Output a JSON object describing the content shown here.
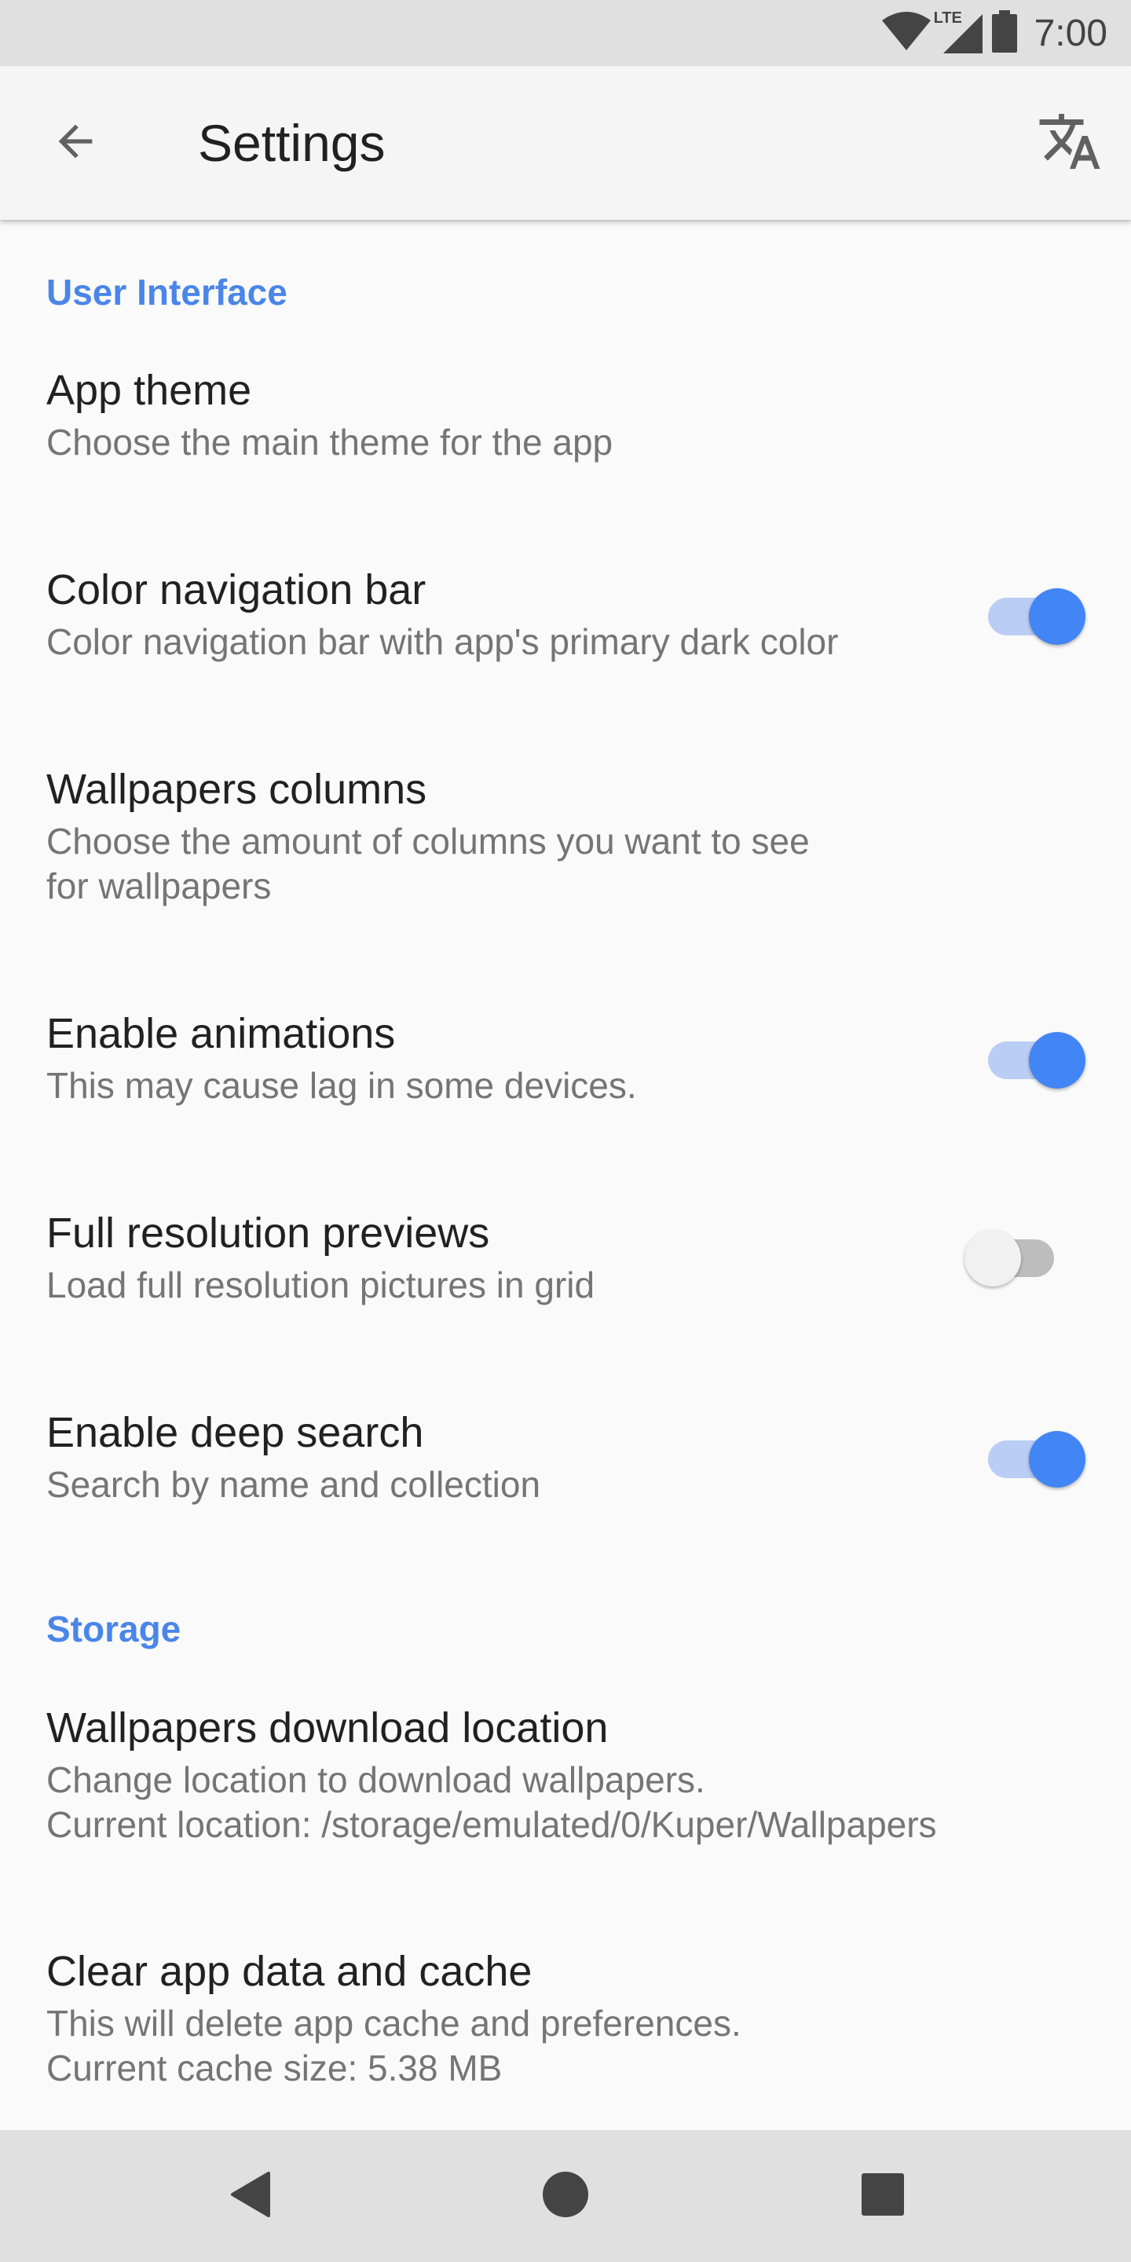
{
  "status_bar": {
    "time": "7:00",
    "icons": [
      "wifi-icon",
      "lte-signal-icon",
      "battery-icon"
    ],
    "network_label": "LTE"
  },
  "app_bar": {
    "title": "Settings",
    "back_icon": "arrow-back-icon",
    "action_icon": "translate-icon"
  },
  "sections": [
    {
      "header": "User Interface",
      "items": [
        {
          "title": "App theme",
          "summary": "Choose the main theme for the app",
          "switch": null
        },
        {
          "title": "Color navigation bar",
          "summary": "Color navigation bar with app's primary dark color",
          "switch": true
        },
        {
          "title": "Wallpapers columns",
          "summary": "Choose the amount of columns you want to see\nfor wallpapers",
          "switch": null
        },
        {
          "title": "Enable animations",
          "summary": "This may cause lag in some devices.",
          "switch": true
        },
        {
          "title": "Full resolution previews",
          "summary": "Load full resolution pictures in grid",
          "switch": false
        },
        {
          "title": "Enable deep search",
          "summary": "Search by name and collection",
          "switch": true
        }
      ]
    },
    {
      "header": "Storage",
      "items": [
        {
          "title": "Wallpapers download location",
          "summary": "Change location to download wallpapers.\nCurrent location: /storage/emulated/0/Kuper/Wallpapers",
          "switch": null
        },
        {
          "title": "Clear app data and cache",
          "summary": "This will delete app cache and preferences.\nCurrent cache size: 5.38 MB",
          "switch": null
        }
      ]
    }
  ],
  "nav_bar": {
    "icons": [
      "back-triangle-icon",
      "home-circle-icon",
      "recents-square-icon"
    ]
  },
  "colors": {
    "accent": "#4a86e8",
    "switch_on_thumb": "#4285f4",
    "switch_on_track": "#b9cdf5"
  }
}
